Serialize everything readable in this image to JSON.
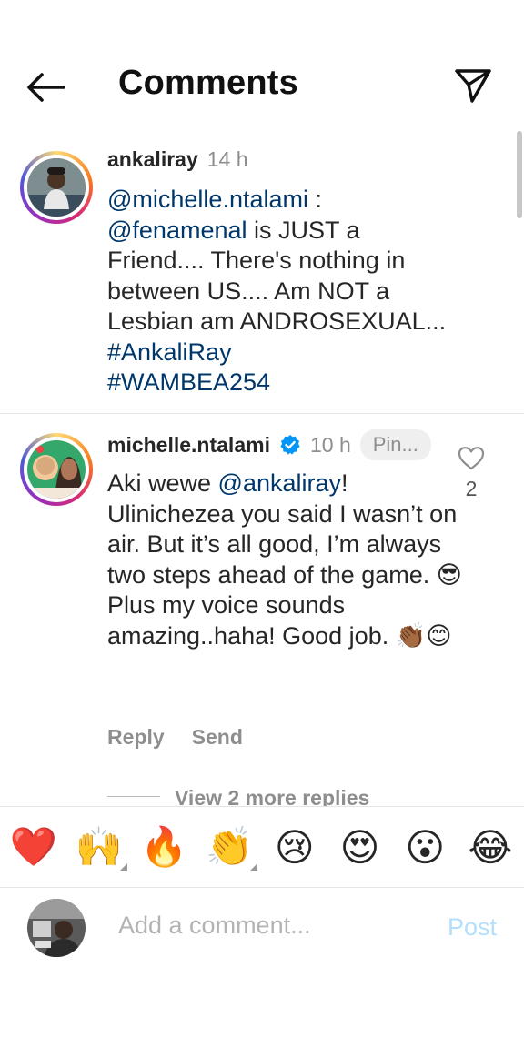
{
  "header": {
    "title": "Comments"
  },
  "comments": [
    {
      "username": "ankaliray",
      "time": "14 h",
      "segments": [
        {
          "text": "@michelle.ntalami",
          "kind": "mention"
        },
        {
          "text": " :\n",
          "kind": "plain"
        },
        {
          "text": "@fenamenal",
          "kind": "mention"
        },
        {
          "text": " is JUST a Friend.... There's nothing in between US.... Am NOT a Lesbian am ANDROSEXUAL...\n",
          "kind": "plain"
        },
        {
          "text": "#AnkaliRay",
          "kind": "hashtag"
        },
        {
          "text": "\n",
          "kind": "plain"
        },
        {
          "text": "#WAMBEA254",
          "kind": "hashtag"
        }
      ]
    },
    {
      "username": "michelle.ntalami",
      "verified": true,
      "time": "10 h",
      "pinned_label": "Pin...",
      "like_count": "2",
      "segments": [
        {
          "text": "Aki wewe ",
          "kind": "plain"
        },
        {
          "text": "@ankaliray",
          "kind": "mention"
        },
        {
          "text": "! Ulinichezea you said I wasn’t on air. But it’s all good, I’m always two steps ahead of the game. 😎 Plus my voice sounds amazing..haha! Good job. 👏🏾😊",
          "kind": "plain"
        }
      ],
      "actions": {
        "reply": "Reply",
        "send": "Send"
      },
      "view_more": "View 2 more replies"
    }
  ],
  "emoji_bar": [
    {
      "char": "❤️",
      "name": "heart-emoji",
      "variants": false
    },
    {
      "char": "🙌",
      "name": "raising-hands-emoji",
      "variants": true
    },
    {
      "char": "🔥",
      "name": "fire-emoji",
      "variants": false
    },
    {
      "char": "👏",
      "name": "clapping-hands-emoji",
      "variants": true
    },
    {
      "char": "😢",
      "name": "crying-face-emoji",
      "variants": false
    },
    {
      "char": "😍",
      "name": "heart-eyes-emoji",
      "variants": false
    },
    {
      "char": "😮",
      "name": "surprised-face-emoji",
      "variants": false
    },
    {
      "char": "😂",
      "name": "tears-of-joy-emoji",
      "variants": false
    }
  ],
  "composer": {
    "placeholder": "Add a comment...",
    "post_label": "Post"
  },
  "colors": {
    "link": "#00376b",
    "muted": "#8e8e8e",
    "post": "#b2dffc",
    "verified": "#0095f6"
  }
}
